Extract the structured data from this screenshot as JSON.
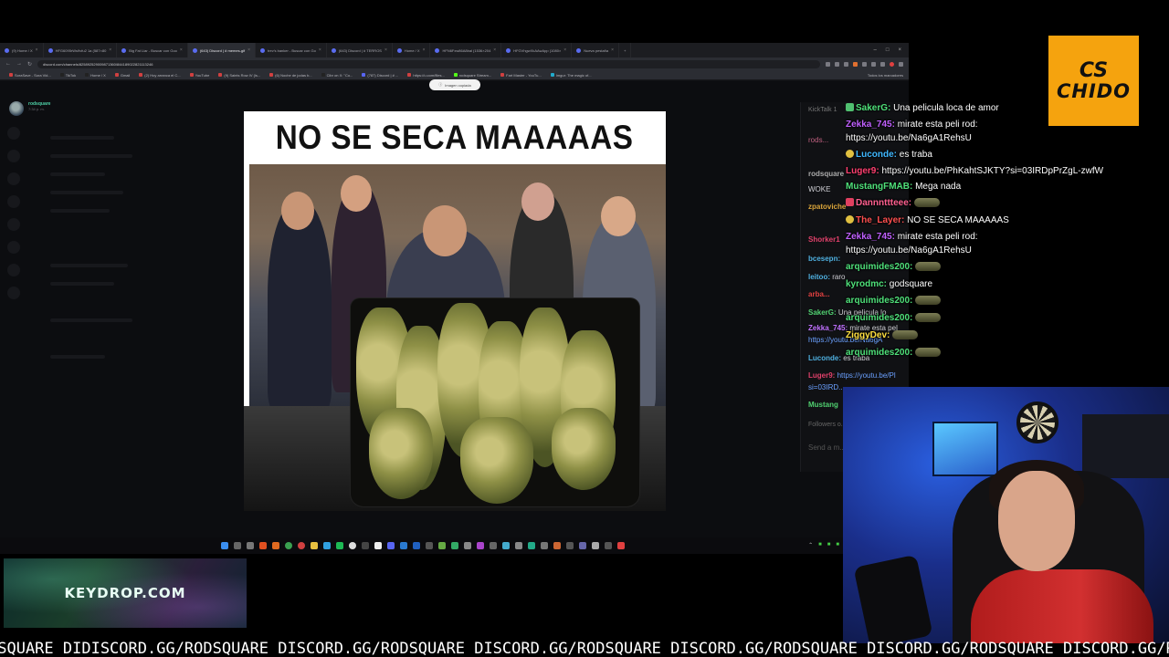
{
  "browser": {
    "tabs": [
      {
        "label": "(9) Home / X",
        "active": false
      },
      {
        "label": "HFG6095rWs9vfu2 1a (587×80",
        "active": false
      },
      {
        "label": "Big Fat Liar - Buscar con Goo",
        "active": false
      },
      {
        "label": "(643) Discord | # memes-gif",
        "active": true
      },
      {
        "label": "trev's banker - Buscar con Go",
        "active": false
      },
      {
        "label": "(643) Discord | # TERROS",
        "active": false
      },
      {
        "label": "Home / X",
        "active": false
      },
      {
        "label": "HFN6Fxw86A8bal (1536×204",
        "active": false
      },
      {
        "label": "HFGVhgwXkAAwApp (1080×",
        "active": false
      },
      {
        "label": "Nueva pestaña",
        "active": false
      }
    ],
    "address": "discord.com/channels/825892529009871360/844189022821113246",
    "bookmarks": [
      "SoraSave - Sora Vid...",
      "TikTok",
      "Home / X",
      "Gmail",
      "(2) Hoy arranca el C...",
      "YouTube",
      "(9) Saints Row IV (ls...",
      "(6) Noche de jodas b...",
      "Cibr on X: \"Co...",
      "(787) Discord | # ...",
      "https://u.com/files...",
      "rodsquare Stream...",
      "Fart Master - YouTu...",
      "Imgur: The magic of..."
    ],
    "bookmarks_all": "Todos los marcadores",
    "toast": "Imagen copiada"
  },
  "discord": {
    "username": "rodsquare",
    "time": "7:34 p. m."
  },
  "meme": {
    "caption": "NO SE SECA MAAAAAS"
  },
  "kick_chat": {
    "header": "KickTalk 1",
    "channel": "rods...",
    "lines": [
      {
        "user": "rodsquare",
        "text": "",
        "color": "#aaaaaa"
      },
      {
        "user": "",
        "text": "WOKE",
        "color": "#ffffff"
      },
      {
        "user": "zpatoviche",
        "text": "",
        "color": "#d9a43a"
      },
      {
        "user": "Shorker1",
        "text": "",
        "color": "#e0406a"
      },
      {
        "user": "bcesepn:",
        "text": "",
        "color": "#4fb0e0"
      },
      {
        "user": "leitoo:",
        "text": "raro",
        "color": "#4fb0e0"
      },
      {
        "user": "arba...",
        "text": "",
        "color": "#e04040"
      },
      {
        "user": "SakerG:",
        "text": "Una pelicula lo",
        "color": "#50d070"
      },
      {
        "user": "Zekka_745:",
        "text": "mirate esta pel",
        "color": "#c070ff"
      },
      {
        "user": "",
        "text": "https://youtu.be/Na6gA",
        "color": "#6aa0ff"
      },
      {
        "user": "Luconde:",
        "text": "es traba",
        "color": "#4fb0e0"
      },
      {
        "user": "Luger9:",
        "text": "https://youtu.be/Pl",
        "color": "#e0406a"
      },
      {
        "user": "",
        "text": "si=03IRD...",
        "color": "#6aa0ff"
      },
      {
        "user": "Mustang",
        "text": "",
        "color": "#50d070"
      }
    ],
    "followers": "Followers o...",
    "send_placeholder": "Send a m..."
  },
  "stream_chat": [
    {
      "user": "SakerG:",
      "text": " Una pelicula loca de amor",
      "color": "#4fe07a",
      "badge": true
    },
    {
      "user": "Zekka_745:",
      "text": " mirate esta peli rod:",
      "color": "#c060ff",
      "badge": false
    },
    {
      "user": "",
      "text": "https://youtu.be/Na6gA1RehsU",
      "color": "#ffffff",
      "badge": false
    },
    {
      "user": "Luconde:",
      "text": " es traba",
      "color": "#40b8ff",
      "badge": true
    },
    {
      "user": "Luger9:",
      "text": " https://youtu.be/PhKahtSJKTY?si=03IRDpPrZgL-zwfW",
      "color": "#ff4070",
      "badge": false
    },
    {
      "user": "MustangFMAB:",
      "text": " Mega nada",
      "color": "#4fe07a",
      "badge": false
    },
    {
      "user": "Dannnttteee:",
      "text": "",
      "color": "#ff6090",
      "badge": true,
      "emote": true
    },
    {
      "user": "The_Layer:",
      "text": " NO SE SECA MAAAAAS",
      "color": "#ff5050",
      "badge": true
    },
    {
      "user": "Zekka_745:",
      "text": " mirate esta peli rod:",
      "color": "#c060ff",
      "badge": false
    },
    {
      "user": "",
      "text": "https://youtu.be/Na6gA1RehsU",
      "color": "#ffffff",
      "badge": false
    },
    {
      "user": "arquimides200:",
      "text": "",
      "color": "#4fe07a",
      "badge": false,
      "emote": true
    },
    {
      "user": "kyrodmc:",
      "text": " godsquare",
      "color": "#4fe07a",
      "badge": false
    },
    {
      "user": "arquimides200:",
      "text": "",
      "color": "#4fe07a",
      "badge": false,
      "emote": true
    },
    {
      "user": "arquimides200:",
      "text": "",
      "color": "#4fe07a",
      "badge": false,
      "emote": true
    },
    {
      "user": "ZiggyDev:",
      "text": "",
      "color": "#ffe040",
      "badge": false,
      "emote": true
    },
    {
      "user": "arquimides200:",
      "text": "",
      "color": "#4fe07a",
      "badge": false,
      "emote": true
    }
  ],
  "logo": {
    "top": "CS",
    "bottom": "CHIDO",
    "color": "#f5a30e"
  },
  "keydrop": {
    "text": "KEYDROP.COM"
  },
  "ticker": {
    "text": "DSQUARE DIDISCORD.GG/RODSQUARE DISCORD.GG/RODSQUARE DISCORD.GG/RODSQUARE DISCORD.GG/RODSQUARE DISCORD.GG/RODSQUARE DISCORD.GG/R"
  },
  "taskbar_icons": [
    "windows-start-icon",
    "search-icon",
    "taskview-icon",
    "brave-icon",
    "firefox-icon",
    "chrome-icon",
    "chrome-alt-icon",
    "folder-icon",
    "telegram-icon",
    "spotify-icon",
    "obs-icon",
    "notion-icon",
    "file-icon",
    "discord-icon",
    "vscode-icon",
    "app-icon",
    "app-icon",
    "app-icon",
    "app-icon",
    "app-icon",
    "app-icon",
    "app-icon",
    "app-icon",
    "app-icon",
    "app-icon",
    "app-icon",
    "app-icon",
    "app-icon",
    "app-icon",
    "app-icon",
    "app-icon",
    "kick-icon"
  ]
}
